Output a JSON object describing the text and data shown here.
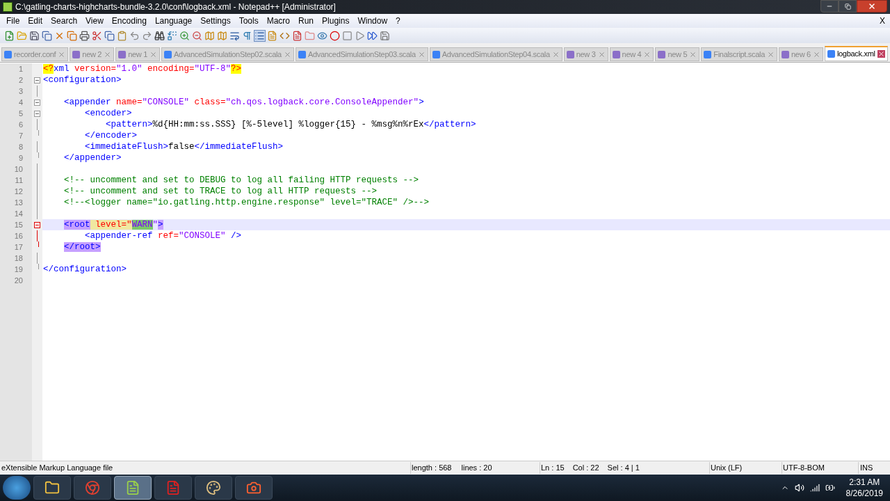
{
  "window": {
    "title": "C:\\gatling-charts-highcharts-bundle-3.2.0\\conf\\logback.xml - Notepad++ [Administrator]"
  },
  "menu": [
    "File",
    "Edit",
    "Search",
    "View",
    "Encoding",
    "Language",
    "Settings",
    "Tools",
    "Macro",
    "Run",
    "Plugins",
    "Window",
    "?"
  ],
  "menu_close": "X",
  "tabs": [
    {
      "label": "recorder.conf",
      "selected": false,
      "color": "#3b82f6"
    },
    {
      "label": "new 2",
      "selected": false,
      "color": "#8b6fc9"
    },
    {
      "label": "new 1",
      "selected": false,
      "color": "#8b6fc9"
    },
    {
      "label": "AdvancedSimulationStep02.scala",
      "selected": false,
      "color": "#3b82f6"
    },
    {
      "label": "AdvancedSimulationStep03.scala",
      "selected": false,
      "color": "#3b82f6"
    },
    {
      "label": "AdvancedSimulationStep04.scala",
      "selected": false,
      "color": "#3b82f6"
    },
    {
      "label": "new 3",
      "selected": false,
      "color": "#8b6fc9"
    },
    {
      "label": "new 4",
      "selected": false,
      "color": "#8b6fc9"
    },
    {
      "label": "new 5",
      "selected": false,
      "color": "#8b6fc9"
    },
    {
      "label": "Finalscript.scala",
      "selected": false,
      "color": "#3b82f6"
    },
    {
      "label": "new 6",
      "selected": false,
      "color": "#8b6fc9"
    },
    {
      "label": "logback.xml",
      "selected": true,
      "color": "#3b82f6"
    }
  ],
  "lines": [
    {
      "n": "1",
      "kind": "plain",
      "current": false,
      "tokens": [
        {
          "t": "<?",
          "kind": "pi"
        },
        {
          "t": "xml",
          "kind": "tag"
        },
        {
          "t": " version=",
          "kind": "attr"
        },
        {
          "t": "\"1.0\"",
          "kind": "value"
        },
        {
          "t": " encoding=",
          "kind": "attr"
        },
        {
          "t": "\"UTF-8\"",
          "kind": "value"
        },
        {
          "t": "?>",
          "kind": "pi"
        }
      ]
    },
    {
      "n": "2",
      "kind": "fold-start",
      "current": false,
      "tokens": [
        {
          "t": "<configuration>",
          "kind": "tag"
        }
      ]
    },
    {
      "n": "3",
      "kind": "fold-body",
      "current": false
    },
    {
      "n": "4",
      "kind": "fold-start",
      "current": false,
      "tokens": [
        {
          "t": "    <appender",
          "kind": "tag"
        },
        {
          "t": " name=",
          "kind": "attr"
        },
        {
          "t": "\"CONSOLE\"",
          "kind": "value"
        },
        {
          "t": " class=",
          "kind": "attr"
        },
        {
          "t": "\"ch.qos.logback.core.ConsoleAppender\"",
          "kind": "value"
        },
        {
          "t": ">",
          "kind": "tag"
        }
      ]
    },
    {
      "n": "5",
      "kind": "fold-start",
      "current": false,
      "tokens": [
        {
          "t": "        <encoder>",
          "kind": "tag"
        }
      ]
    },
    {
      "n": "6",
      "kind": "fold-body",
      "current": false,
      "tokens": [
        {
          "t": "            <pattern>",
          "kind": "tag"
        },
        {
          "t": "%d{HH:mm:ss.SSS} [%-5level] %logger{15} - %msg%n%rEx",
          "kind": "text"
        },
        {
          "t": "</pattern>",
          "kind": "tag"
        }
      ]
    },
    {
      "n": "7",
      "kind": "fold-end",
      "current": false,
      "tokens": [
        {
          "t": "        </encoder>",
          "kind": "tag"
        }
      ]
    },
    {
      "n": "8",
      "kind": "fold-body",
      "current": false,
      "tokens": [
        {
          "t": "        <immediateFlush>",
          "kind": "tag"
        },
        {
          "t": "false",
          "kind": "text"
        },
        {
          "t": "</immediateFlush>",
          "kind": "tag"
        }
      ]
    },
    {
      "n": "9",
      "kind": "fold-end",
      "current": false,
      "tokens": [
        {
          "t": "    </appender>",
          "kind": "tag"
        }
      ]
    },
    {
      "n": "10",
      "kind": "fold-body",
      "current": false
    },
    {
      "n": "11",
      "kind": "fold-body",
      "current": false,
      "tokens": [
        {
          "t": "    <!-- uncomment and set to DEBUG to log all failing HTTP requests -->",
          "kind": "comment"
        }
      ]
    },
    {
      "n": "12",
      "kind": "fold-body",
      "current": false,
      "tokens": [
        {
          "t": "    <!-- uncomment and set to TRACE to log all HTTP requests -->",
          "kind": "comment"
        }
      ]
    },
    {
      "n": "13",
      "kind": "fold-body",
      "current": false,
      "tokens": [
        {
          "t": "    <!--<logger name=\"io.gatling.http.engine.response\" level=\"TRACE\" />-->",
          "kind": "comment"
        }
      ]
    },
    {
      "n": "14",
      "kind": "fold-body",
      "current": false
    },
    {
      "n": "15",
      "kind": "fold-start-active",
      "current": true,
      "tokens": [
        {
          "t": "    <root",
          "kind": "match"
        },
        {
          "t": " level=\"",
          "kind": "attr-hl"
        },
        {
          "t": "WARN",
          "kind": "selection"
        },
        {
          "t": "\"",
          "kind": "value"
        },
        {
          "t": ">",
          "kind": "match"
        }
      ]
    },
    {
      "n": "16",
      "kind": "fold-body-active",
      "current": false,
      "tokens": [
        {
          "t": "        <appender-ref",
          "kind": "tag"
        },
        {
          "t": " ref=",
          "kind": "attr"
        },
        {
          "t": "\"CONSOLE\"",
          "kind": "value"
        },
        {
          "t": " />",
          "kind": "tag"
        }
      ]
    },
    {
      "n": "17",
      "kind": "fold-end-active",
      "current": false,
      "tokens": [
        {
          "t": "    </root>",
          "kind": "match"
        }
      ]
    },
    {
      "n": "18",
      "kind": "fold-body",
      "current": false
    },
    {
      "n": "19",
      "kind": "fold-end",
      "current": false,
      "tokens": [
        {
          "t": "</configuration>",
          "kind": "tag"
        }
      ]
    },
    {
      "n": "20",
      "kind": "plain",
      "current": false
    }
  ],
  "status_bar": {
    "file_type": "eXtensible Markup Language file",
    "length": "length : 568",
    "lines": "lines : 20",
    "ln": "Ln : 15",
    "col": "Col : 22",
    "sel": "Sel : 4 | 1",
    "eol": "Unix (LF)",
    "encoding": "UTF-8-BOM",
    "mode": "INS"
  },
  "taskbar_apps": [
    {
      "selected": false
    },
    {
      "selected": false
    },
    {
      "selected": true
    },
    {
      "selected": false
    },
    {
      "selected": false
    },
    {
      "selected": false
    }
  ],
  "clock": {
    "time": "2:31 AM",
    "date": "8/26/2019"
  }
}
